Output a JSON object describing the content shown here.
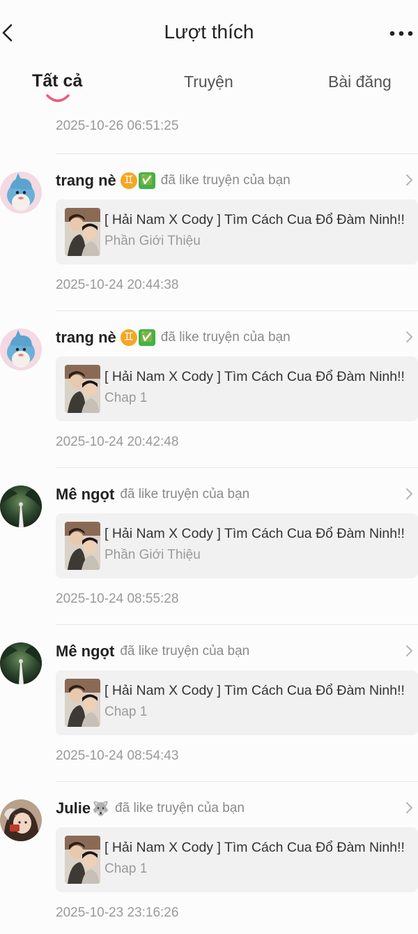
{
  "header": {
    "title": "Lượt thích",
    "back_icon": "chevron-left-icon",
    "more_icon": "more-horizontal-icon"
  },
  "tabs": [
    {
      "label": "Tất cả",
      "active": true
    },
    {
      "label": "Truyện",
      "active": false
    },
    {
      "label": "Bài đăng",
      "active": false
    }
  ],
  "accent_color": "#ef5a7b",
  "top_timestamp": "2025-10-26 06:51:25",
  "items": [
    {
      "user": "trang nè",
      "badges": [
        "♊",
        "✅"
      ],
      "action": "đã like truyện của bạn",
      "story_title": "[ Hải Nam X Cody ] Tìm Cách Cua Đổ Đàm Ninh!!",
      "chapter": "Phần Giới Thiệu",
      "timestamp": "2025-10-24 20:44:38"
    },
    {
      "user": "trang nè",
      "badges": [
        "♊",
        "✅"
      ],
      "action": "đã like truyện của bạn",
      "story_title": "[ Hải Nam X Cody ] Tìm Cách Cua Đổ Đàm Ninh!!",
      "chapter": "Chap 1",
      "timestamp": "2025-10-24 20:42:48"
    },
    {
      "user": "Mê ngọt",
      "badges": [],
      "action": "đã like truyện của bạn",
      "story_title": "[ Hải Nam X Cody ] Tìm Cách Cua Đổ Đàm Ninh!!",
      "chapter": "Phần Giới Thiệu",
      "timestamp": "2025-10-24 08:55:28"
    },
    {
      "user": "Mê ngọt",
      "badges": [],
      "action": "đã like truyện của bạn",
      "story_title": "[ Hải Nam X Cody ] Tìm Cách Cua Đổ Đàm Ninh!!",
      "chapter": "Chap 1",
      "timestamp": "2025-10-24 08:54:43"
    },
    {
      "user": "Julie",
      "badges": [
        "🐺"
      ],
      "action": "đã like truyện của bạn",
      "story_title": "[ Hải Nam X Cody ] Tìm Cách Cua Đổ Đàm Ninh!!",
      "chapter": "Chap 1",
      "timestamp": "2025-10-23 23:16:26"
    }
  ]
}
